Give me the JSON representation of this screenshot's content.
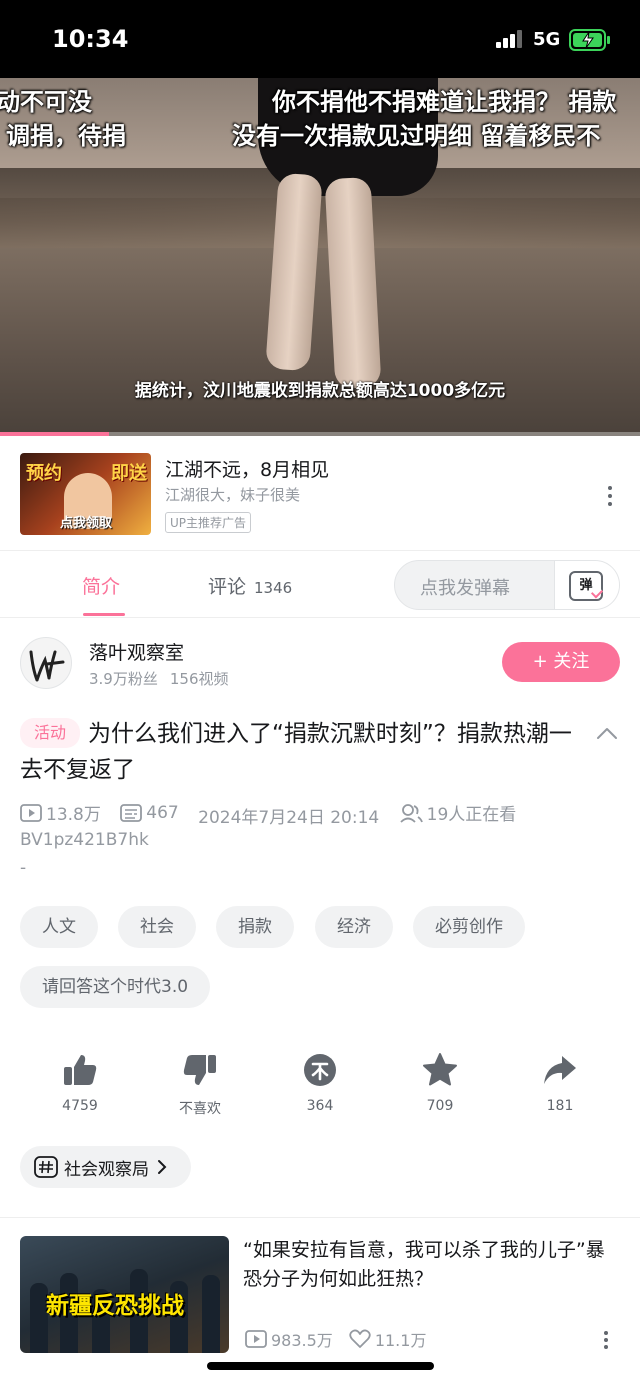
{
  "status_bar": {
    "time": "10:34",
    "network": "5G"
  },
  "video": {
    "danmu": [
      "动不可没",
      "你不捐他不捐难道让我捐？ 捐款",
      "调捐，待捐",
      "没有一次捐款见过明细  留着移民不"
    ],
    "subtitle": "据统计，汶川地震收到捐款总额高达1000多亿元",
    "progress": 0.17
  },
  "ad": {
    "thumb_text_left": "预约",
    "thumb_text_right": "即送",
    "thumb_text_bottom": "点我领取",
    "title": "江湖不远，8月相见",
    "subtitle": "江湖很大，妹子很美",
    "tag": "UP主推荐广告"
  },
  "tabs": {
    "intro": "简介",
    "comments": "评论",
    "comments_count": "1346",
    "danmu_placeholder": "点我发弹幕",
    "danmu_icon_text": "弹"
  },
  "uploader": {
    "name": "落叶观察室",
    "fans": "3.9万粉丝",
    "videos": "156视频",
    "follow_label": "+ 关注"
  },
  "video_info": {
    "badge": "活动",
    "title": "为什么我们进入了“捐款沉默时刻”？捐款热潮一去不复返了",
    "views": "13.8万",
    "danmaku": "467",
    "date": "2024年7月24日 20:14",
    "watching": "19人正在看",
    "bvid": "BV1pz421B7hk",
    "desc": "-"
  },
  "tags": [
    "人文",
    "社会",
    "捐款",
    "经济",
    "必剪创作",
    "请回答这个时代3.0"
  ],
  "actions": {
    "like": "4759",
    "dislike": "不喜欢",
    "coin": "364",
    "favorite": "709",
    "share": "181"
  },
  "channel": {
    "label": "社会观察局"
  },
  "recommendation": {
    "thumb_caption": "新疆反恐挑战",
    "title": "“如果安拉有旨意，我可以杀了我的儿子”暴恐分子为何如此狂热？",
    "views": "983.5万",
    "likes": "11.1万"
  },
  "colors": {
    "accent": "#fb7299",
    "text": "#18191c",
    "muted": "#9499a0"
  }
}
